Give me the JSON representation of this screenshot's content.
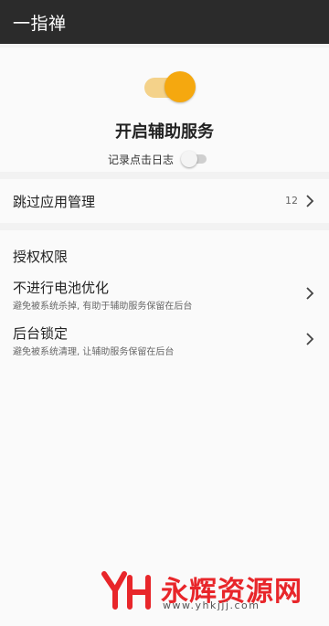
{
  "app": {
    "title": "一指禅"
  },
  "service": {
    "title": "开启辅助服务",
    "enabled": true,
    "log_label": "记录点击日志",
    "log_enabled": false
  },
  "skip": {
    "title": "跳过应用管理",
    "count": "12"
  },
  "permissions": {
    "section_title": "授权权限",
    "items": [
      {
        "title": "不进行电池优化",
        "subtitle": "避免被系统杀掉, 有助于辅助服务保留在后台"
      },
      {
        "title": "后台锁定",
        "subtitle": "避免被系统清理, 让辅助服务保留在后台"
      }
    ]
  },
  "watermark": {
    "brand": "永辉资源网",
    "url": "www.yhkjjj.com"
  },
  "colors": {
    "appbar": "#2b2b2b",
    "accent": "#f5a80f",
    "accent_track": "#f4d28a",
    "watermark": "#e8262a"
  }
}
